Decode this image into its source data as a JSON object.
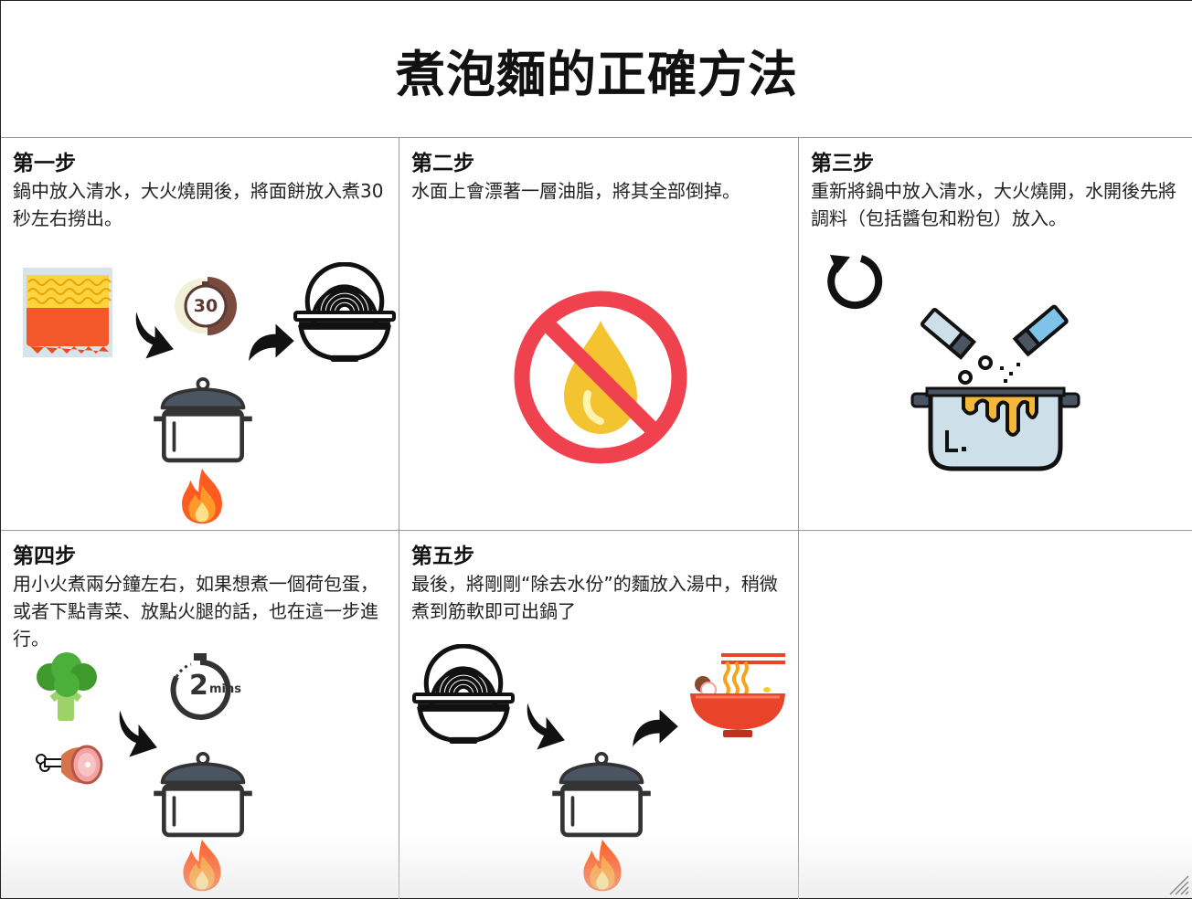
{
  "title": "煮泡麵的正確方法",
  "steps": [
    {
      "title": "第一步",
      "text": "鍋中放入清水，大火燒開後，將面餅放入煮30秒左右撈出。",
      "timer_label": "30"
    },
    {
      "title": "第二步",
      "text": "水面上會漂著一層油脂，將其全部倒掉。"
    },
    {
      "title": "第三步",
      "text": "重新將鍋中放入清水，大火燒開，水開後先將調料（包括醬包和粉包）放入。"
    },
    {
      "title": "第四步",
      "text": "用小火煮兩分鐘左右，如果想煮一個荷包蛋，或者下點青菜、放點火腿的話，也在這一步進行。",
      "timer_number": "2",
      "timer_unit": "mins"
    },
    {
      "title": "第五步",
      "text": "最後，將剛剛“除去水份”的麵放入湯中，稍微煮到筋軟即可出鍋了"
    }
  ],
  "icons": [
    "noodle-block-icon",
    "timer-icon",
    "noodle-bowl-icon",
    "cooking-pot-icon",
    "fire-icon",
    "no-oil-icon",
    "refresh-icon",
    "seasoning-icon",
    "broccoli-icon",
    "ham-icon",
    "ramen-bowl-icon",
    "arrow-icon"
  ],
  "colors": {
    "no_sign": "#f0414f",
    "oil_drop": "#f4c430",
    "fire": "#ff5a1f",
    "pot_fill": "#cde0ea",
    "noodle": "#ffd23f",
    "broth": "#e8432b"
  }
}
